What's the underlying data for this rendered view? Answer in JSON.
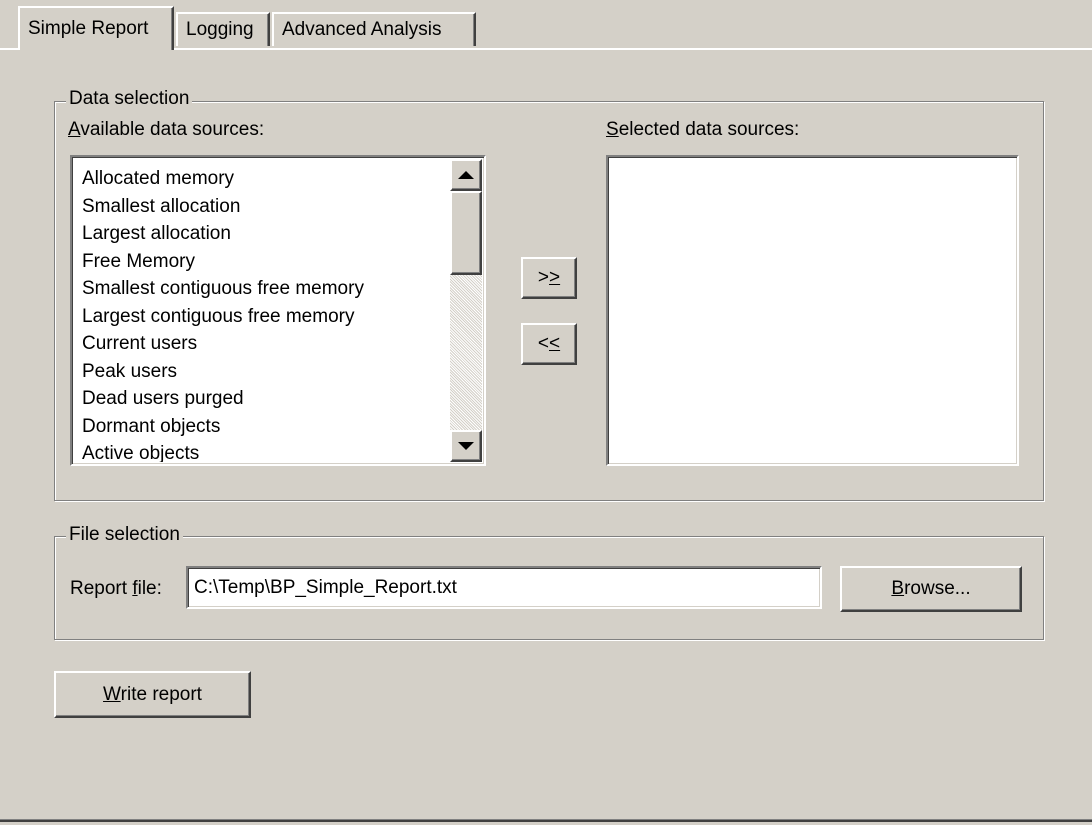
{
  "tabs": [
    {
      "label": "Simple Report",
      "active": true
    },
    {
      "label": "Logging",
      "active": false
    },
    {
      "label": "Advanced Analysis",
      "active": false
    }
  ],
  "data_selection": {
    "title": "Data selection",
    "available_label_mnemonic": "A",
    "available_label_rest": "vailable data sources:",
    "selected_label_mnemonic": "S",
    "selected_label_rest": "elected data sources:",
    "available_items": [
      "Allocated memory",
      "Smallest allocation",
      "Largest allocation",
      "Free Memory",
      "Smallest contiguous free memory",
      "Largest contiguous free memory",
      "Current users",
      "Peak users",
      "Dead users purged",
      "Dormant objects",
      "Active objects"
    ],
    "selected_items": [],
    "add_button": {
      "prefix": ">",
      "mnemonic": ">"
    },
    "remove_button": {
      "prefix": "<",
      "mnemonic": "<"
    }
  },
  "file_selection": {
    "title": "File selection",
    "report_label_prefix": "Report ",
    "report_label_mnemonic": "f",
    "report_label_suffix": "ile:",
    "report_file_value": "C:\\Temp\\BP_Simple_Report.txt",
    "browse_mnemonic": "B",
    "browse_rest": "rowse..."
  },
  "write_report": {
    "mnemonic": "W",
    "rest": "rite report"
  },
  "icons": {
    "scroll_up": "scroll-up-arrow-icon",
    "scroll_down": "scroll-down-arrow-icon"
  },
  "colors": {
    "face": "#d4d0c8",
    "field": "#ffffff",
    "shadow": "#808080",
    "highlight": "#ffffff"
  }
}
